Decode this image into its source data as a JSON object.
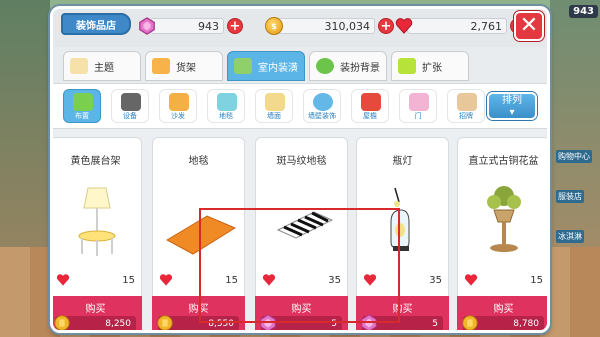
{
  "background": {
    "top_badge": "943",
    "side_labels": [
      "购物中心",
      "服装店",
      "冰淇淋"
    ]
  },
  "header": {
    "shop_title": "装饰品店",
    "gems": "943",
    "coins": "310,034",
    "hearts": "2,761",
    "plus": "+",
    "close": "✕"
  },
  "tabs": [
    {
      "label": "主题"
    },
    {
      "label": "货架"
    },
    {
      "label": "室内装潢"
    },
    {
      "label": "装扮背景"
    },
    {
      "label": "扩张"
    }
  ],
  "subcategories": [
    {
      "label": "布置"
    },
    {
      "label": "设备"
    },
    {
      "label": "沙发"
    },
    {
      "label": "地毯"
    },
    {
      "label": "墙面"
    },
    {
      "label": "墙壁装饰"
    },
    {
      "label": "屋檐"
    },
    {
      "label": "门"
    },
    {
      "label": "招牌"
    }
  ],
  "sort": {
    "label": "排列",
    "arrow": "▾"
  },
  "items": [
    {
      "name": "黄色展台架",
      "hearts": "15",
      "buy": "购买",
      "price": "8,250",
      "currency": "coin"
    },
    {
      "name": "地毯",
      "hearts": "15",
      "buy": "购买",
      "price": "8,550",
      "currency": "coin"
    },
    {
      "name": "斑马纹地毯",
      "hearts": "35",
      "buy": "购买",
      "price": "5",
      "currency": "gem"
    },
    {
      "name": "瓶灯",
      "hearts": "35",
      "buy": "购买",
      "price": "5",
      "currency": "gem"
    },
    {
      "name": "直立式古铜花盆",
      "hearts": "15",
      "buy": "购买",
      "price": "8,780",
      "currency": "coin"
    }
  ],
  "colors": {
    "accent_blue": "#5bb5e6",
    "buy_red": "#e0325e",
    "close_red": "#e3383f",
    "highlight": "#d72a2a"
  }
}
